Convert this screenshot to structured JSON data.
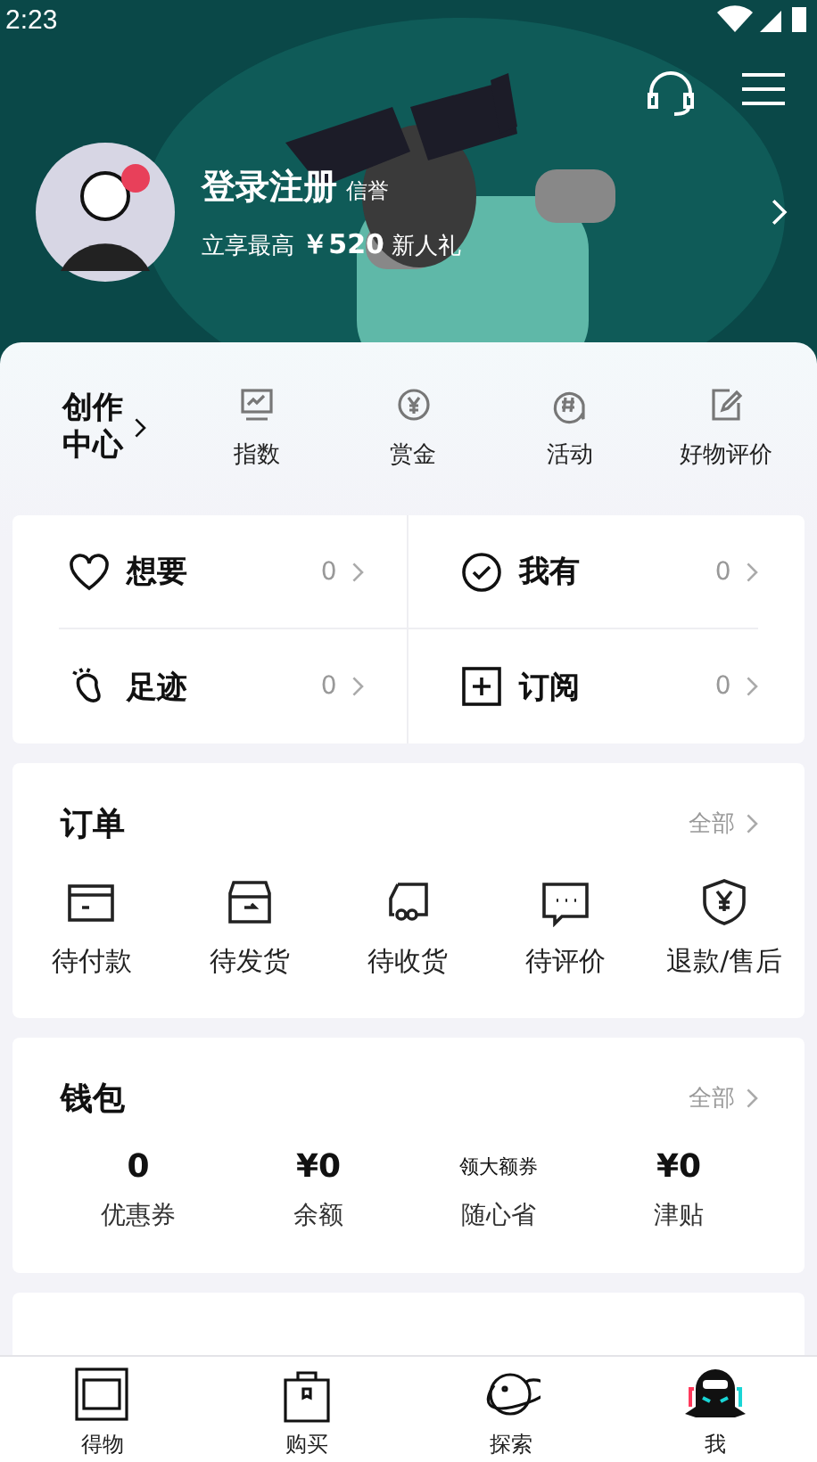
{
  "status_bar": {
    "time": "2:23"
  },
  "profile": {
    "name": "登录注册",
    "badge": "信誉",
    "promo_prefix": "立享最高",
    "promo_amount": "￥520",
    "promo_suffix": "新人礼"
  },
  "creator": {
    "title_line1": "创作",
    "title_line2": "中心",
    "items": [
      {
        "kind": "index",
        "label": "指数"
      },
      {
        "kind": "bounty",
        "label": "赏金"
      },
      {
        "kind": "activity",
        "label": "活动"
      },
      {
        "kind": "review",
        "label": "好物评价"
      }
    ]
  },
  "collections": [
    {
      "kind": "want",
      "label": "想要",
      "count": "0"
    },
    {
      "kind": "own",
      "label": "我有",
      "count": "0"
    },
    {
      "kind": "footprint",
      "label": "足迹",
      "count": "0"
    },
    {
      "kind": "subscribe",
      "label": "订阅",
      "count": "0"
    }
  ],
  "orders": {
    "title": "订单",
    "all": "全部",
    "items": [
      {
        "kind": "pay",
        "label": "待付款"
      },
      {
        "kind": "ship",
        "label": "待发货"
      },
      {
        "kind": "receive",
        "label": "待收货"
      },
      {
        "kind": "comment",
        "label": "待评价"
      },
      {
        "kind": "refund",
        "label": "退款/售后"
      }
    ]
  },
  "wallet": {
    "title": "钱包",
    "all": "全部",
    "items": [
      {
        "value": "0",
        "label": "优惠券"
      },
      {
        "value": "¥0",
        "label": "余额"
      },
      {
        "value": "领大额券",
        "label": "随心省",
        "kind": "hint"
      },
      {
        "value": "¥0",
        "label": "津贴"
      }
    ]
  },
  "tab_bar": [
    {
      "kind": "home",
      "label": "得物",
      "selected": false
    },
    {
      "kind": "buy",
      "label": "购买",
      "selected": false
    },
    {
      "kind": "explore",
      "label": "探索",
      "selected": false
    },
    {
      "kind": "me",
      "label": "我",
      "selected": true
    }
  ]
}
